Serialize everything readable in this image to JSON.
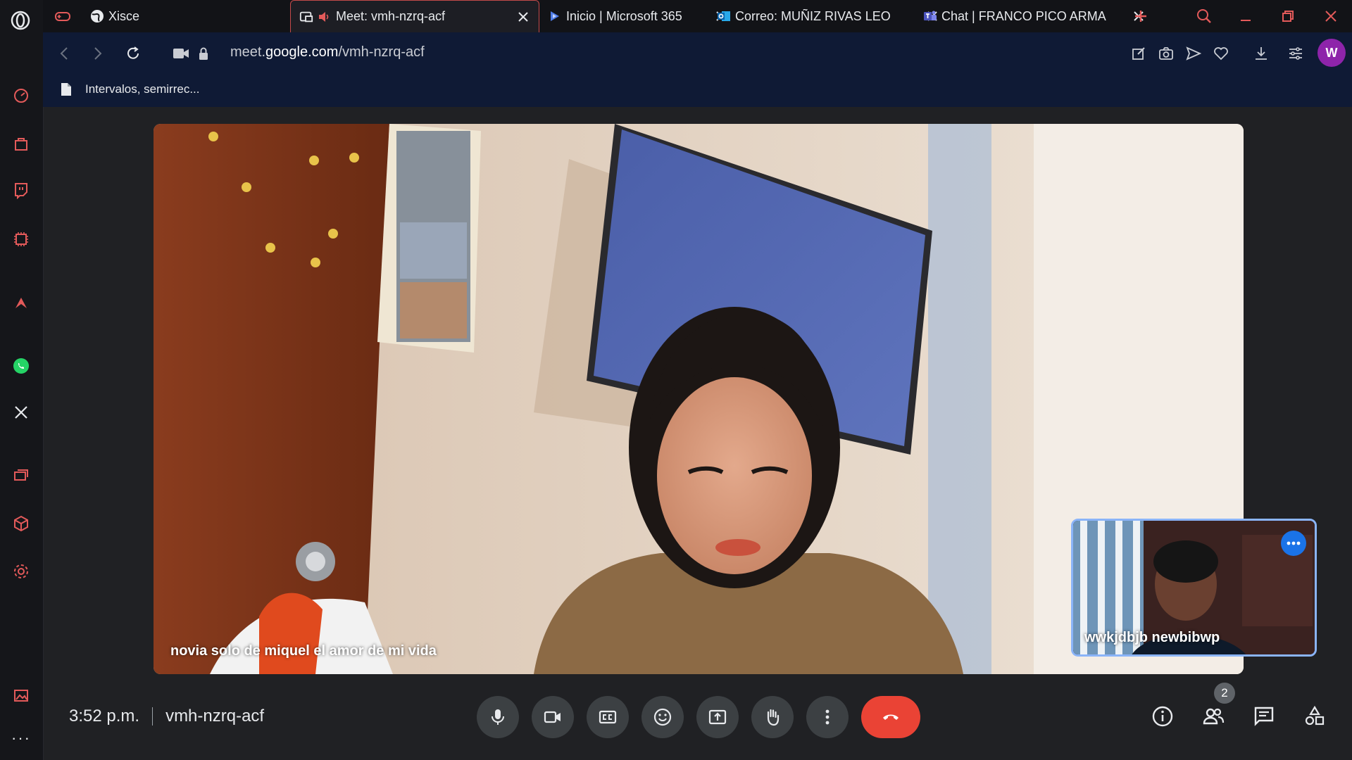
{
  "browser": {
    "tabs": [
      {
        "title": "Xisce",
        "icon": "globe-icon"
      },
      {
        "title": "Meet: vmh-nzrq-acf",
        "icon": "meet-icon",
        "audio": true
      },
      {
        "title": "Inicio | Microsoft 365",
        "icon": "copilot-icon"
      },
      {
        "title": "Correo: MUÑIZ RIVAS LEO",
        "icon": "outlook-icon"
      },
      {
        "title": "Chat | FRANCO PICO ARMA",
        "icon": "teams-icon"
      }
    ],
    "url_prefix": "meet.",
    "url_domain": "google.com",
    "url_path": "/vmh-nzrq-acf",
    "avatar_letter": "W",
    "bookmark": "Intervalos, semirrec..."
  },
  "meeting": {
    "time": "3:52 p.m.",
    "code": "vmh-nzrq-acf",
    "main_caption": "novia solo de miquel el amor de mi vida",
    "pip_name": "wwkjdbjb newbibwp",
    "participants_count": "2"
  },
  "colors": {
    "accent": "#8ab4f8",
    "end_call": "#ea4335",
    "avatar": "#8e24aa"
  }
}
